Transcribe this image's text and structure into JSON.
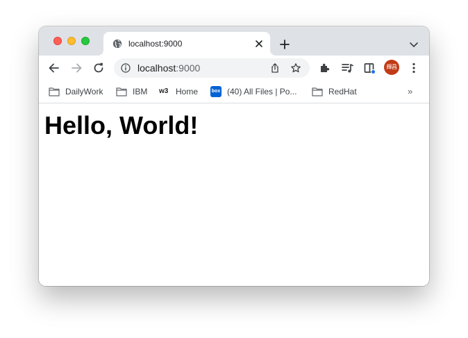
{
  "browser": {
    "tab": {
      "title": "localhost:9000",
      "favicon": "globe-icon"
    },
    "address_bar": {
      "host": "localhost",
      "port": ":9000"
    },
    "profile": {
      "initials": "輝昌",
      "color": "#c13b17"
    },
    "bookmarks": [
      {
        "label": "DailyWork",
        "icon": "folder-icon"
      },
      {
        "label": "IBM",
        "icon": "folder-icon"
      },
      {
        "label": "Home",
        "icon": "w3-icon",
        "icon_text": "w3"
      },
      {
        "label": "(40) All Files | Po...",
        "icon": "box-icon",
        "icon_text": "box"
      },
      {
        "label": "RedHat",
        "icon": "folder-icon"
      }
    ],
    "bookmarks_more": "»"
  },
  "page": {
    "heading": "Hello, World!"
  }
}
